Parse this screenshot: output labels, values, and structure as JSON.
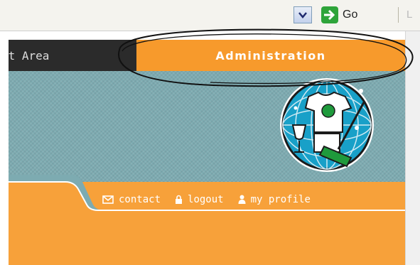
{
  "toolbar": {
    "go_label": "Go",
    "next_button_partial": "L"
  },
  "nav": {
    "client_area_label": "nt Area",
    "admin_label": "Administration"
  },
  "footer_links": [
    {
      "label": "contact",
      "icon": "envelope-icon"
    },
    {
      "label": "logout",
      "icon": "lock-icon"
    },
    {
      "label": "my profile",
      "icon": "person-icon"
    }
  ],
  "colors": {
    "admin_tab": "#f79a2c",
    "nav_bar": "#2b2b2b",
    "teal_band": "#7dabb1",
    "orange_base": "#f7a13a",
    "go_button": "#2ea43a"
  }
}
